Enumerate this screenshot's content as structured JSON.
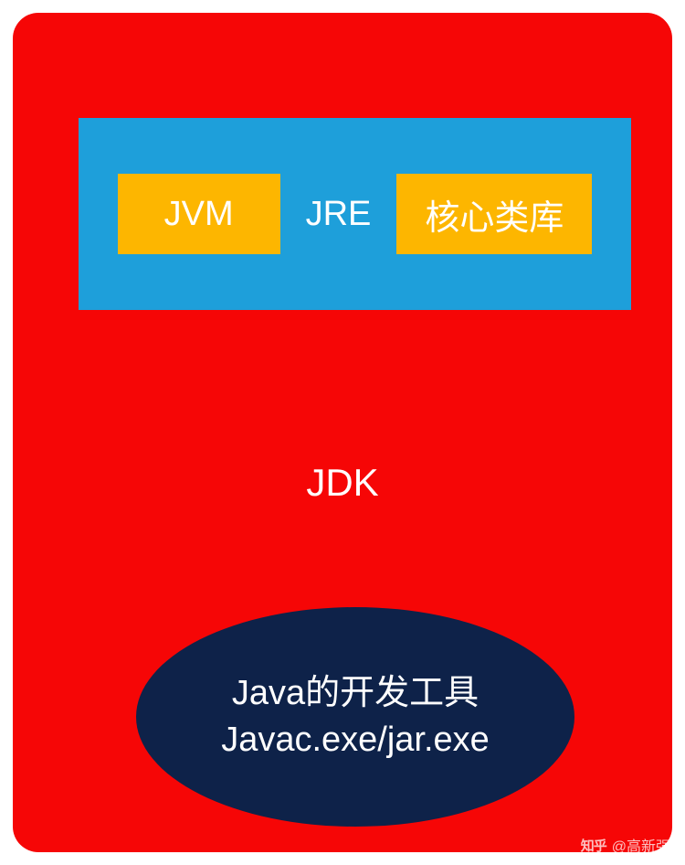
{
  "diagram": {
    "jdk_label": "JDK",
    "jre": {
      "jvm_label": "JVM",
      "jre_label": "JRE",
      "core_lib_label": "核心类库"
    },
    "tools": {
      "line1": "Java的开发工具",
      "line2": "Javac.exe/jar.exe"
    }
  },
  "watermark": {
    "brand": "知乎",
    "author": "@高新强"
  },
  "colors": {
    "jdk_bg": "#f60606",
    "jre_bg": "#1e9fda",
    "box_bg": "#fdb600",
    "ellipse_bg": "#0e2249",
    "text": "#ffffff"
  }
}
